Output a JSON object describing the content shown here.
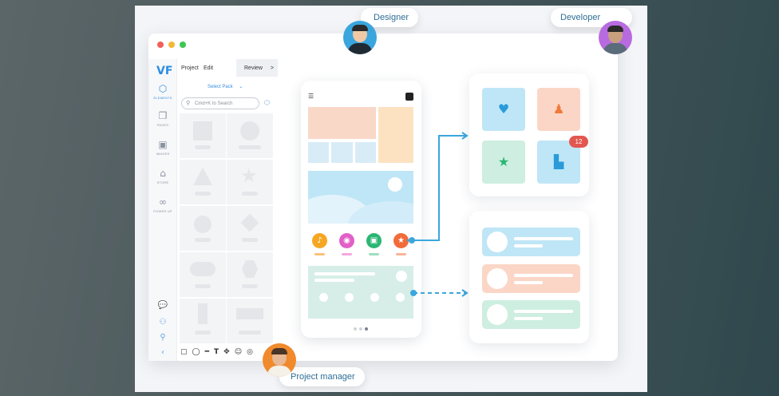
{
  "colors": {
    "accent": "#3a8fdc",
    "connector": "#3ba7dc",
    "badge": "#e2574f"
  },
  "window_controls": [
    "close",
    "minimize",
    "maximize"
  ],
  "menu": {
    "project": "Project",
    "edit": "Edit",
    "review": "Review",
    "review_icon": ">"
  },
  "sidebar": {
    "logo": "VF",
    "items": [
      {
        "label": "ELEMENTS",
        "icon": "cube-icon"
      },
      {
        "label": "PAGES",
        "icon": "pages-icon"
      },
      {
        "label": "IMAGES",
        "icon": "image-icon"
      },
      {
        "label": "STORE",
        "icon": "bag-icon"
      },
      {
        "label": "POWER UP",
        "icon": "infinity-icon"
      }
    ],
    "bottom_icons": [
      "comment-icon",
      "user-tree-icon",
      "zoom-icon",
      "collapse-icon"
    ]
  },
  "panel": {
    "select_pack": "Select Pack",
    "search_placeholder": "Cmd+K to Search"
  },
  "toolbar": {
    "text_tool": "T"
  },
  "phone": {
    "icons": [
      "music-icon",
      "chat-icon",
      "camera-icon",
      "star-icon"
    ]
  },
  "tiles": [
    {
      "icon": "heart-icon"
    },
    {
      "icon": "user-icon"
    },
    {
      "icon": "star-icon"
    },
    {
      "icon": "note-icon"
    }
  ],
  "notification": {
    "count": "12"
  },
  "people": {
    "designer": "Designer",
    "developer": "Developer",
    "project_manager": "Project manager"
  }
}
